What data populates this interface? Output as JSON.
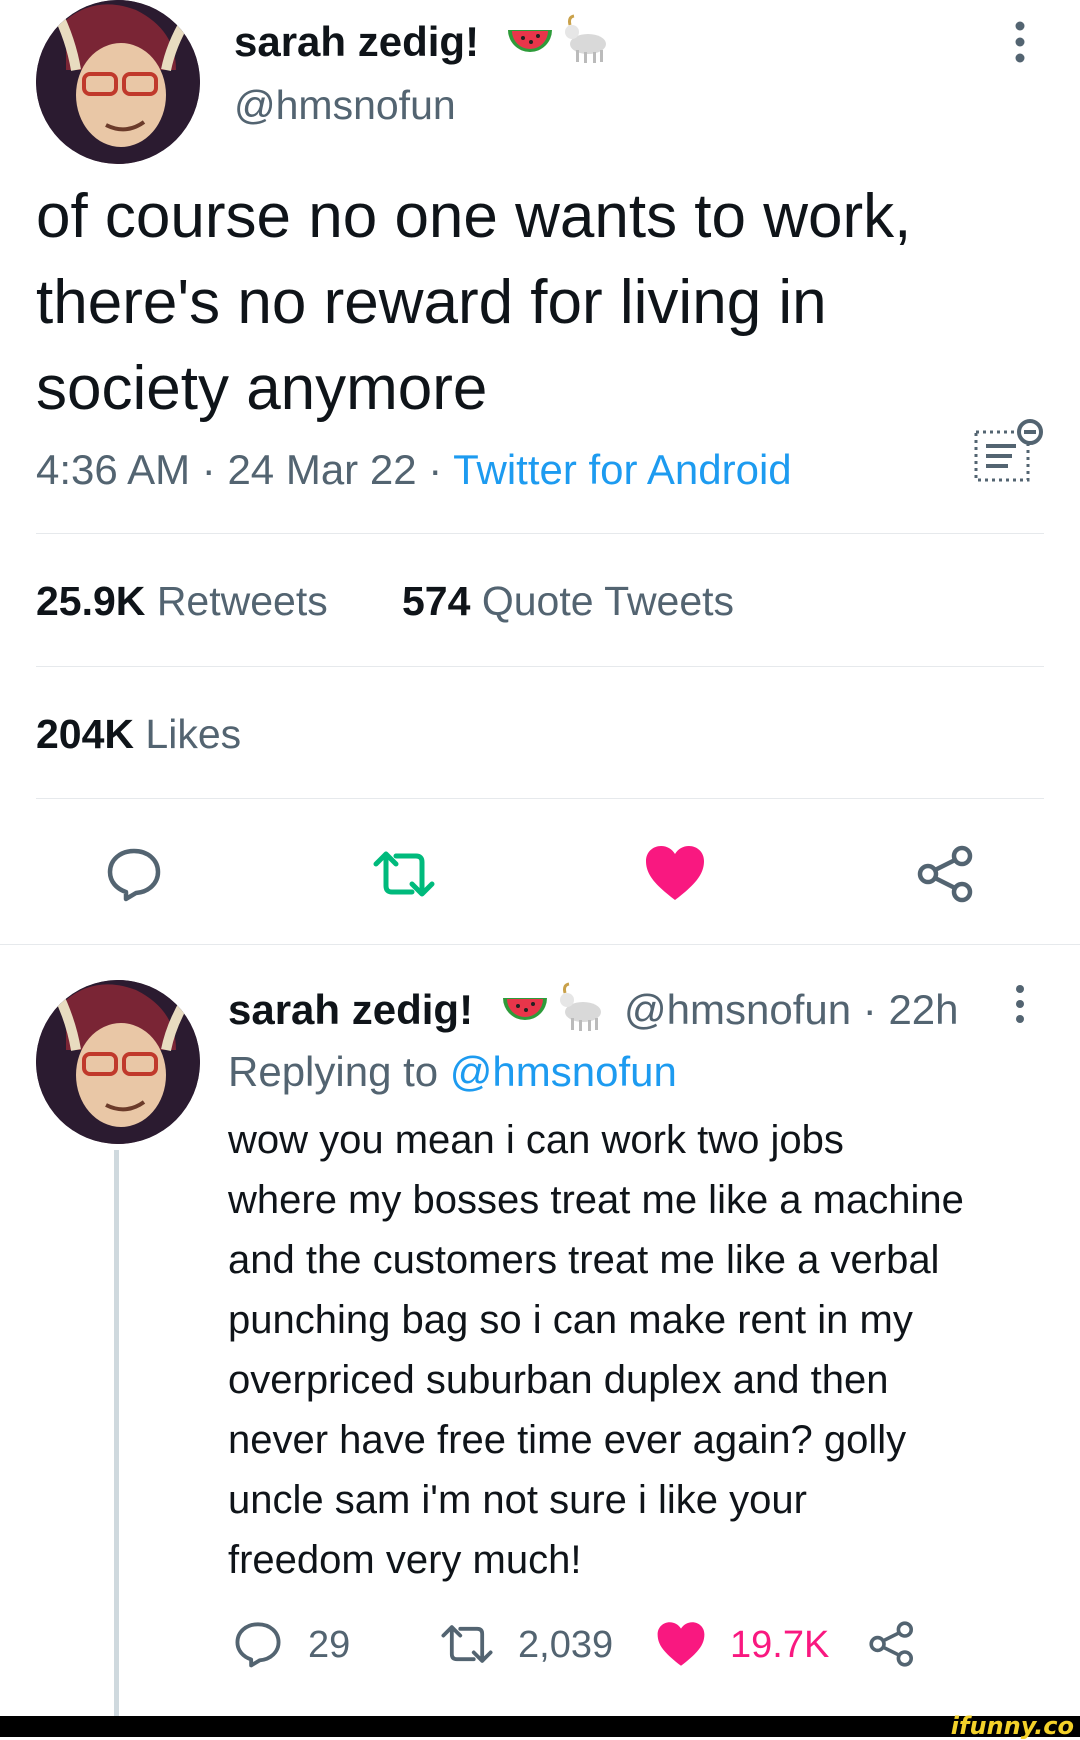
{
  "main_tweet": {
    "display_name": "sarah zedig!",
    "name_emojis": [
      "watermelon-icon",
      "goat-icon"
    ],
    "handle": "@hmsnofun",
    "text_lines": [
      "of course no one wants to work,",
      "there's no reward for living in",
      "society anymore"
    ],
    "time": "4:36 AM",
    "date": "24 Mar 22",
    "separator": "·",
    "source": "Twitter for Android",
    "retweets_count": "25.9K",
    "retweets_label": "Retweets",
    "quote_count": "574",
    "quote_label": "Quote Tweets",
    "likes_count": "204K",
    "likes_label": "Likes"
  },
  "reply": {
    "display_name": "sarah zedig!",
    "handle": "@hmsnofun",
    "time_ago": "22h",
    "separator": "·",
    "replying_prefix": "Replying to",
    "replying_handle": "@hmsnofun",
    "text_lines": [
      "wow you mean i can work two jobs",
      "where my bosses treat me like a machine",
      "and the customers treat me like a verbal",
      "punching bag so i can make rent in my",
      "overpriced suburban duplex and then",
      "never have free time ever again? golly",
      "uncle sam i'm not sure i like your",
      "freedom very much!"
    ],
    "reply_count": "29",
    "retweet_count": "2,039",
    "like_count": "19.7K"
  },
  "watermark": "ifunny.co",
  "colors": {
    "accent": "#1d9bf0",
    "retweet_green": "#00ba7c",
    "like_pink": "#f91880",
    "text_secondary": "#536471"
  }
}
